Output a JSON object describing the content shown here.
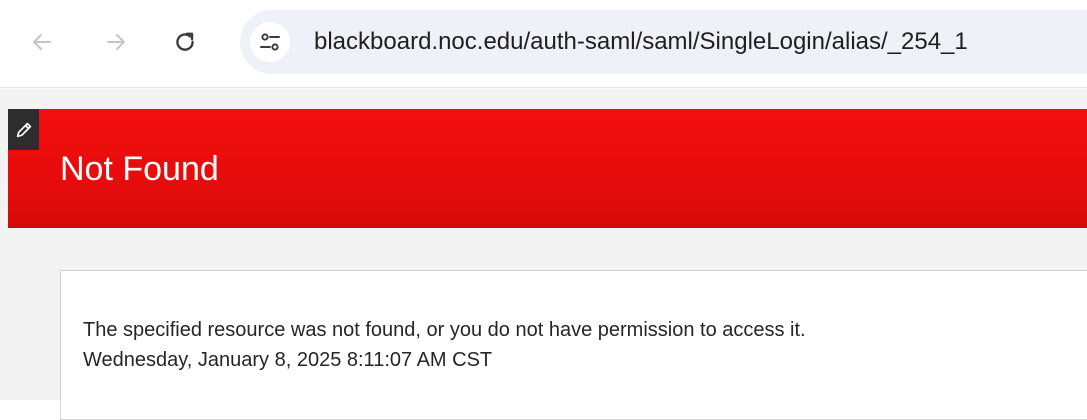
{
  "browser": {
    "url": "blackboard.noc.edu/auth-saml/saml/SingleLogin/alias/_254_1",
    "icons": {
      "back": "arrow-left-icon",
      "forward": "arrow-right-icon",
      "reload": "reload-icon",
      "site_info": "tune-icon"
    }
  },
  "page": {
    "title": "Not Found",
    "message": "The specified resource was not found, or you do not have permission to access it.",
    "timestamp": "Wednesday, January 8, 2025 8:11:07 AM CST",
    "icons": {
      "edit": "pencil-icon"
    }
  },
  "colors": {
    "header": "#e80c0c",
    "page_background": "#f3f3f3",
    "panel_background": "#ffffff",
    "address_bar": "#eef1f8"
  }
}
